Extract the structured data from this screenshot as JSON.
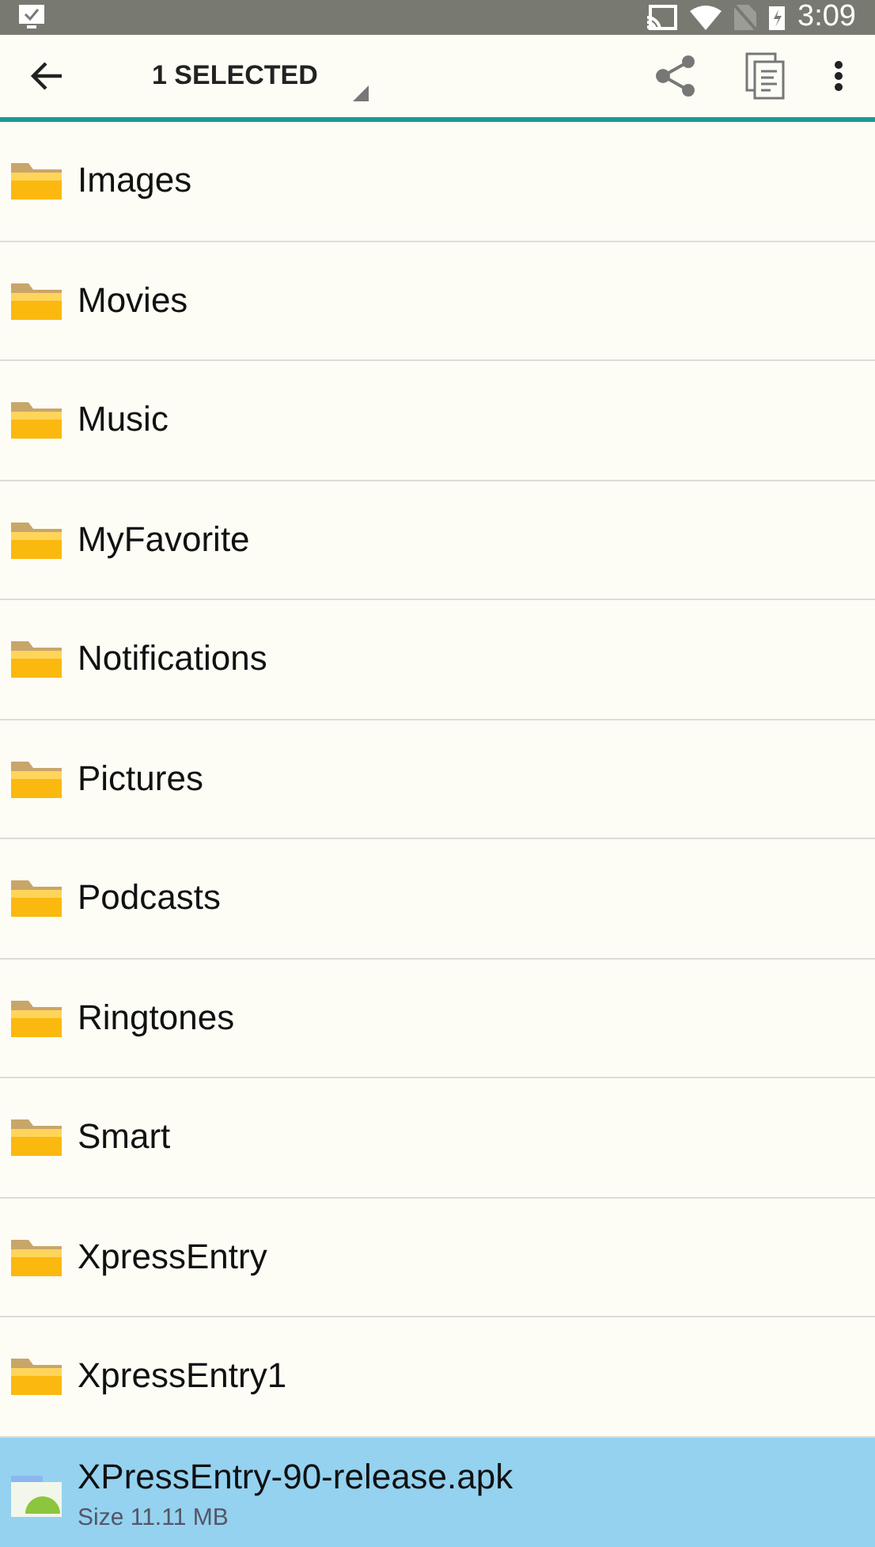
{
  "status_bar": {
    "time": "3:09"
  },
  "toolbar": {
    "title": "1 SELECTED"
  },
  "items": [
    {
      "kind": "folder",
      "name": "Images",
      "selected": false
    },
    {
      "kind": "folder",
      "name": "Movies",
      "selected": false
    },
    {
      "kind": "folder",
      "name": "Music",
      "selected": false
    },
    {
      "kind": "folder",
      "name": "MyFavorite",
      "selected": false
    },
    {
      "kind": "folder",
      "name": "Notifications",
      "selected": false
    },
    {
      "kind": "folder",
      "name": "Pictures",
      "selected": false
    },
    {
      "kind": "folder",
      "name": "Podcasts",
      "selected": false
    },
    {
      "kind": "folder",
      "name": "Ringtones",
      "selected": false
    },
    {
      "kind": "folder",
      "name": "Smart",
      "selected": false
    },
    {
      "kind": "folder",
      "name": "XpressEntry",
      "selected": false
    },
    {
      "kind": "folder",
      "name": "XpressEntry1",
      "selected": false
    },
    {
      "kind": "apk",
      "name": "XPressEntry-90-release.apk",
      "size": "Size 11.11 MB",
      "selected": true
    }
  ]
}
